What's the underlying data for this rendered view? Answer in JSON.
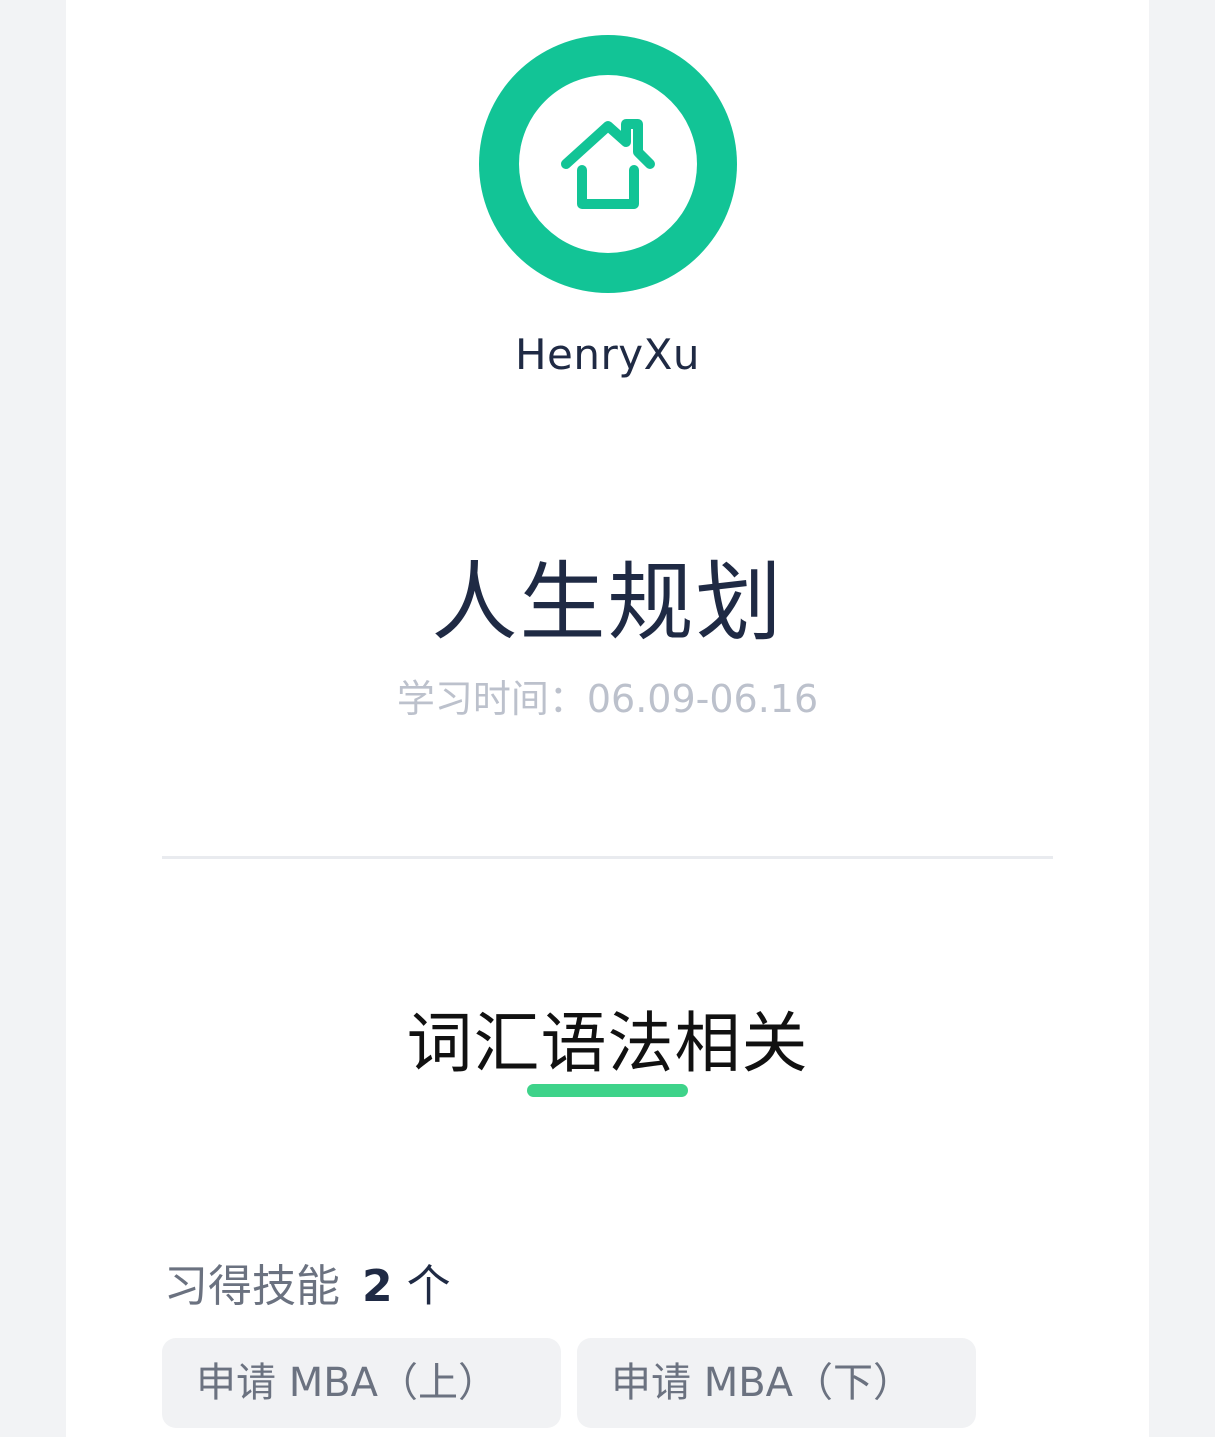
{
  "profile": {
    "avatar_icon": "house-icon",
    "username": "HenryXu"
  },
  "plan": {
    "title": "人生规划",
    "study_time": "学习时间：06.09-06.16"
  },
  "tab": {
    "label": "词汇语法相关"
  },
  "skills": {
    "label": "习得技能",
    "count": "2",
    "unit": "个",
    "items": [
      "申请 MBA（上）",
      "申请 MBA（下）"
    ]
  },
  "colors": {
    "avatar_bg": "#12c496",
    "accent_underline": "#3ed38a",
    "text_dark": "#1f2a44",
    "text_muted": "#bcc1cc"
  }
}
